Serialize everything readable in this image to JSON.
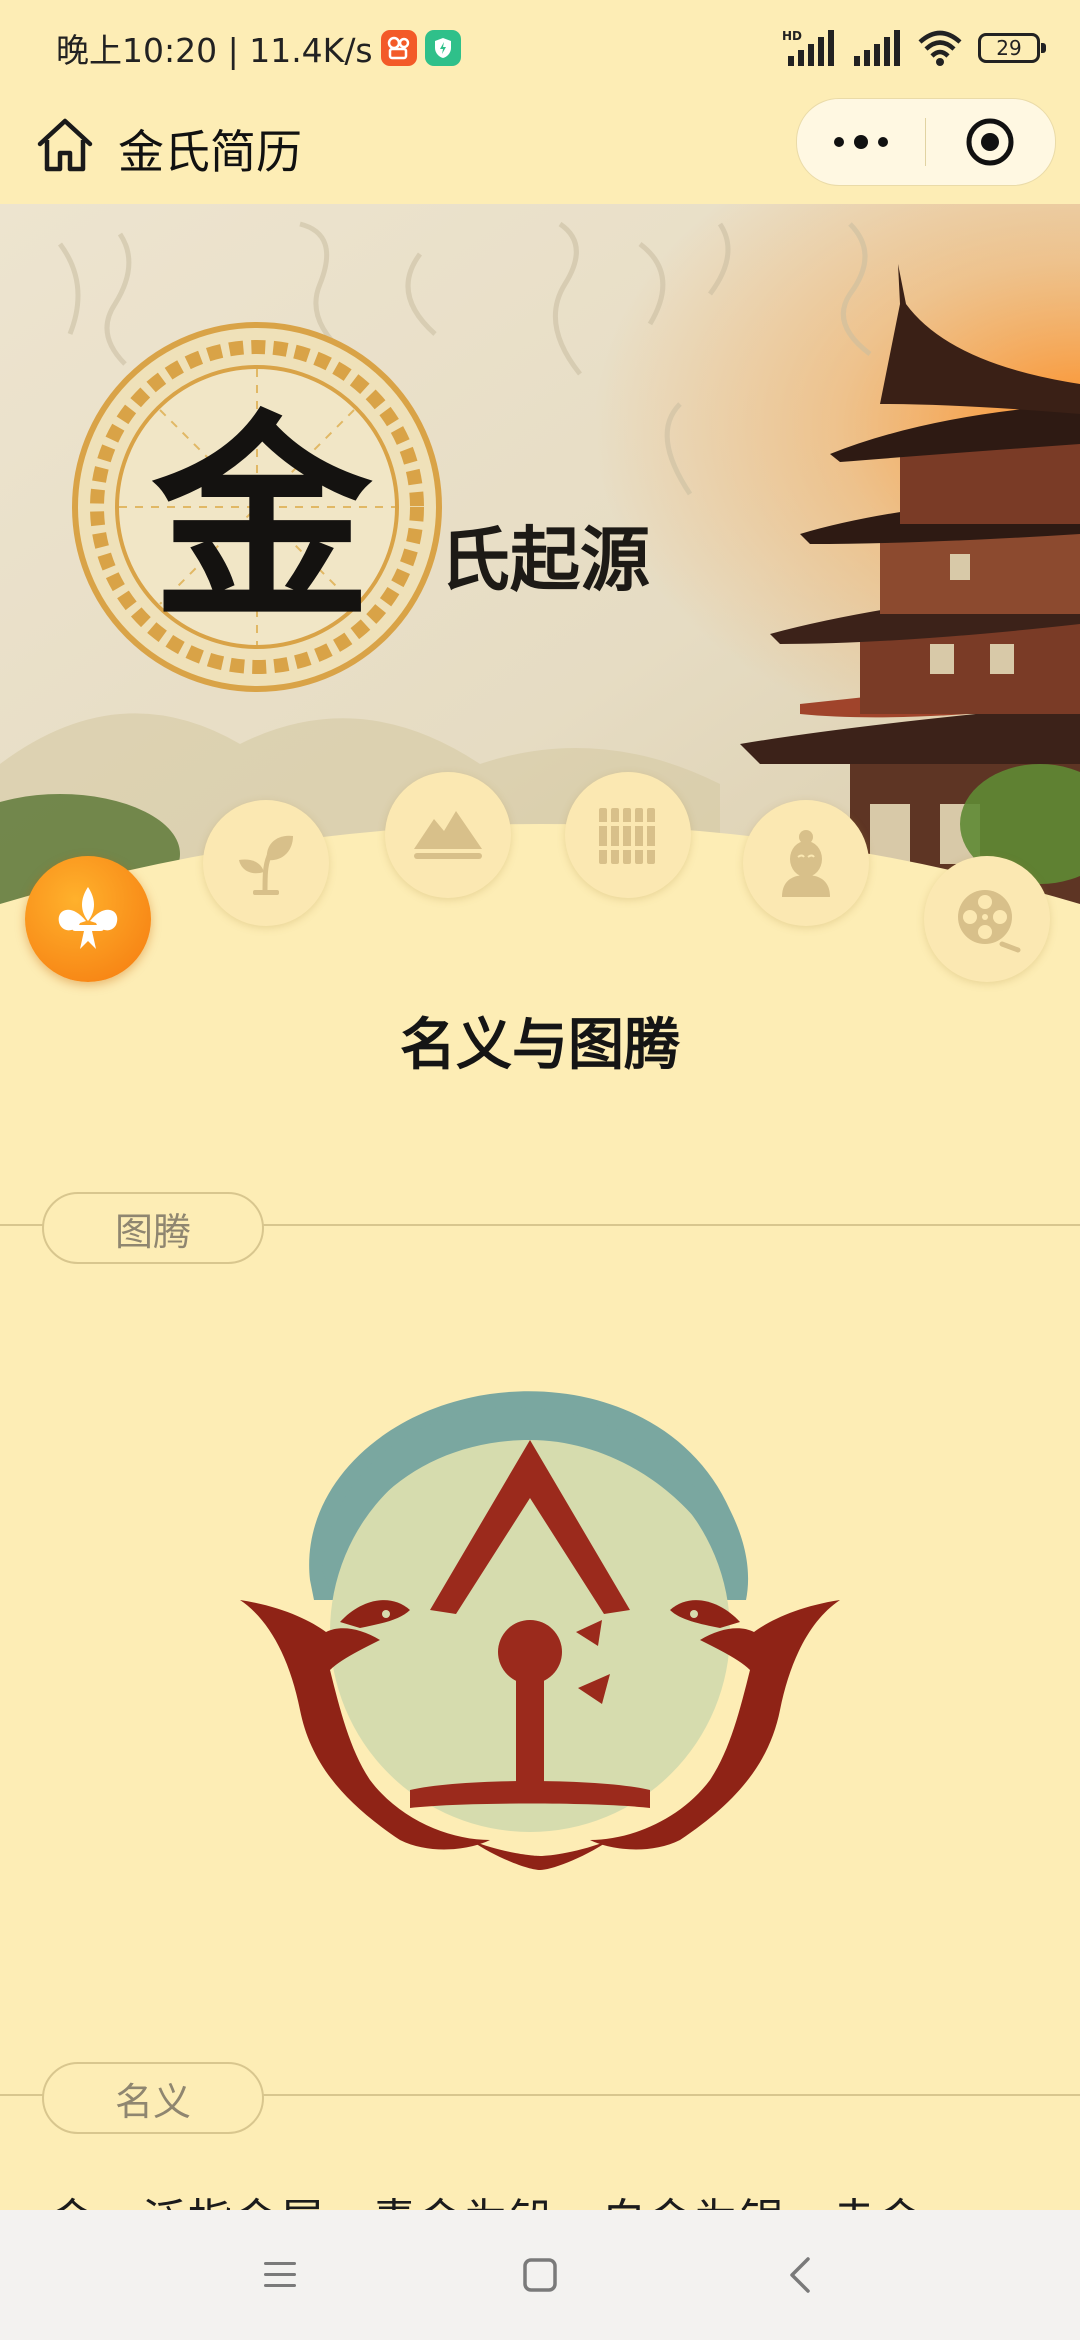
{
  "status_bar": {
    "time_speed": "晚上10:20 | 11.4K/s",
    "battery": "29"
  },
  "header": {
    "title": "金氏简历"
  },
  "banner": {
    "seal_character": "金",
    "title": "氏起源"
  },
  "nav_icons": [
    {
      "name": "fleur-de-lis-icon",
      "active": true
    },
    {
      "name": "sprout-icon",
      "active": false
    },
    {
      "name": "mountain-icon",
      "active": false
    },
    {
      "name": "bamboo-slips-icon",
      "active": false
    },
    {
      "name": "person-icon",
      "active": false
    },
    {
      "name": "film-reel-icon",
      "active": false
    }
  ],
  "content": {
    "heading": "名义与图腾",
    "totem_label": "图腾",
    "meaning_label": "名义",
    "meaning_text": "金，泛指金属，青金为铅，白金为银，赤金"
  },
  "colors": {
    "background": "#fdedb5",
    "accent_orange": "#f57a0f",
    "totem_red": "#9b2a1c",
    "totem_teal": "#7aa7a0"
  }
}
